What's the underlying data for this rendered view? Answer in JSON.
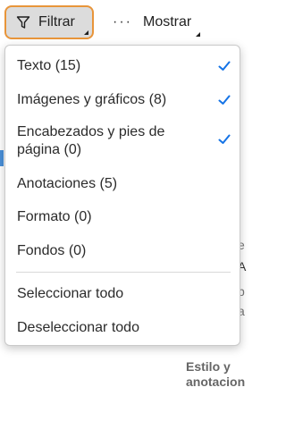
{
  "toolbar": {
    "filter_label": "Filtrar",
    "show_label": "Mostrar",
    "show_dots": "···"
  },
  "accent_color": "#e8953a",
  "check_color": "#1473e6",
  "menu": {
    "items": [
      {
        "label": "Texto (15)",
        "checked": true
      },
      {
        "label": "Imágenes y gráficos (8)",
        "checked": true
      },
      {
        "label": "Encabezados y pies de página (0)",
        "checked": true
      },
      {
        "label": "Anotaciones (5)",
        "checked": false
      },
      {
        "label": "Formato (0)",
        "checked": false
      },
      {
        "label": "Fondos (0)",
        "checked": false
      }
    ],
    "select_all": "Seleccionar todo",
    "deselect_all": "Deseleccionar todo"
  },
  "background": {
    "frag_mid_1": "e",
    "frag_mid_2": "A",
    "frag_mid_3": "p",
    "frag_mid_4": "a",
    "footer": "Estilo y anotacion"
  }
}
